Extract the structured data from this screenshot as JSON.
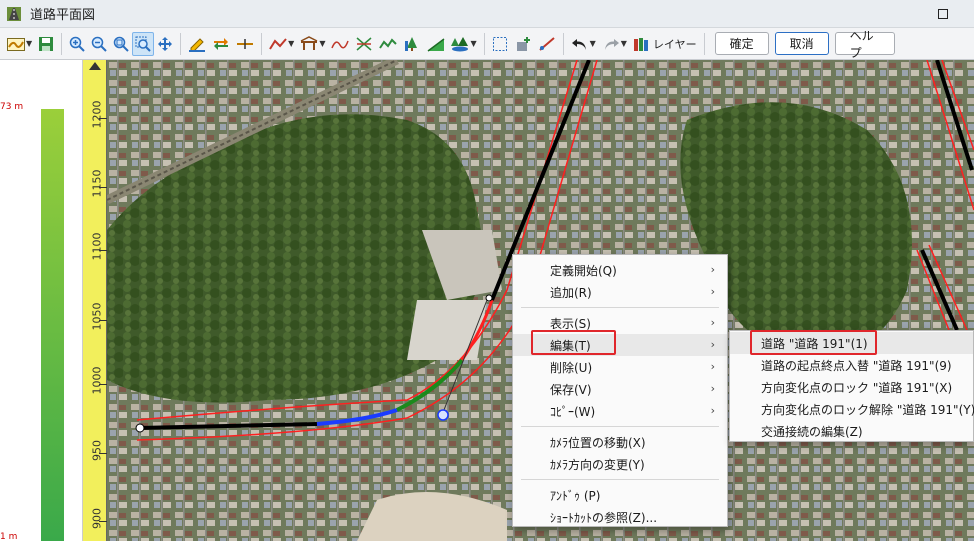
{
  "window": {
    "title": "道路平面図",
    "icon": "road-map-app-icon",
    "maximize_icon": "maximize-icon"
  },
  "toolbar": {
    "layer_label": "レイヤー",
    "confirm_label": "確定",
    "cancel_label": "取消",
    "help_label": "ヘルプ"
  },
  "profile": {
    "elev_max": "73 m",
    "elev_min": "1 m"
  },
  "ruler": {
    "labels": [
      "1200",
      "1150",
      "1100",
      "1050",
      "1000",
      "950",
      "900"
    ]
  },
  "context_menu": {
    "items": [
      {
        "label": "定義開始(Q)",
        "submenu": true
      },
      {
        "label": "追加(R)",
        "submenu": true
      },
      {
        "label": "表示(S)",
        "submenu": true
      },
      {
        "label": "編集(T)",
        "submenu": true
      },
      {
        "label": "削除(U)",
        "submenu": true
      },
      {
        "label": "保存(V)",
        "submenu": true
      },
      {
        "label": "ｺﾋﾟｰ(W)",
        "submenu": true
      },
      {
        "label": "ｶﾒﾗ位置の移動(X)",
        "submenu": false
      },
      {
        "label": "ｶﾒﾗ方向の変更(Y)",
        "submenu": false
      },
      {
        "label": "ｱﾝﾄﾞｩ (P)",
        "submenu": false
      },
      {
        "label": "ｼｮｰﾄｶｯﾄの参照(Z)...",
        "submenu": false
      }
    ],
    "arrow": "›"
  },
  "edit_submenu": {
    "items": [
      "道路 \"道路 191\"(1)",
      "道路の起点終点入替 \"道路 191\"(9)",
      "方向変化点のロック \"道路 191\"(X)",
      "方向変化点のロック解除 \"道路 191\"(Y)",
      "交通接続の編集(Z)"
    ]
  },
  "colors": {
    "highlight_box": "#e0262b",
    "road_black": "#000000",
    "road_blue": "#1a3cff",
    "road_green": "#1c8a1c",
    "road_outline": "#ff2020"
  }
}
